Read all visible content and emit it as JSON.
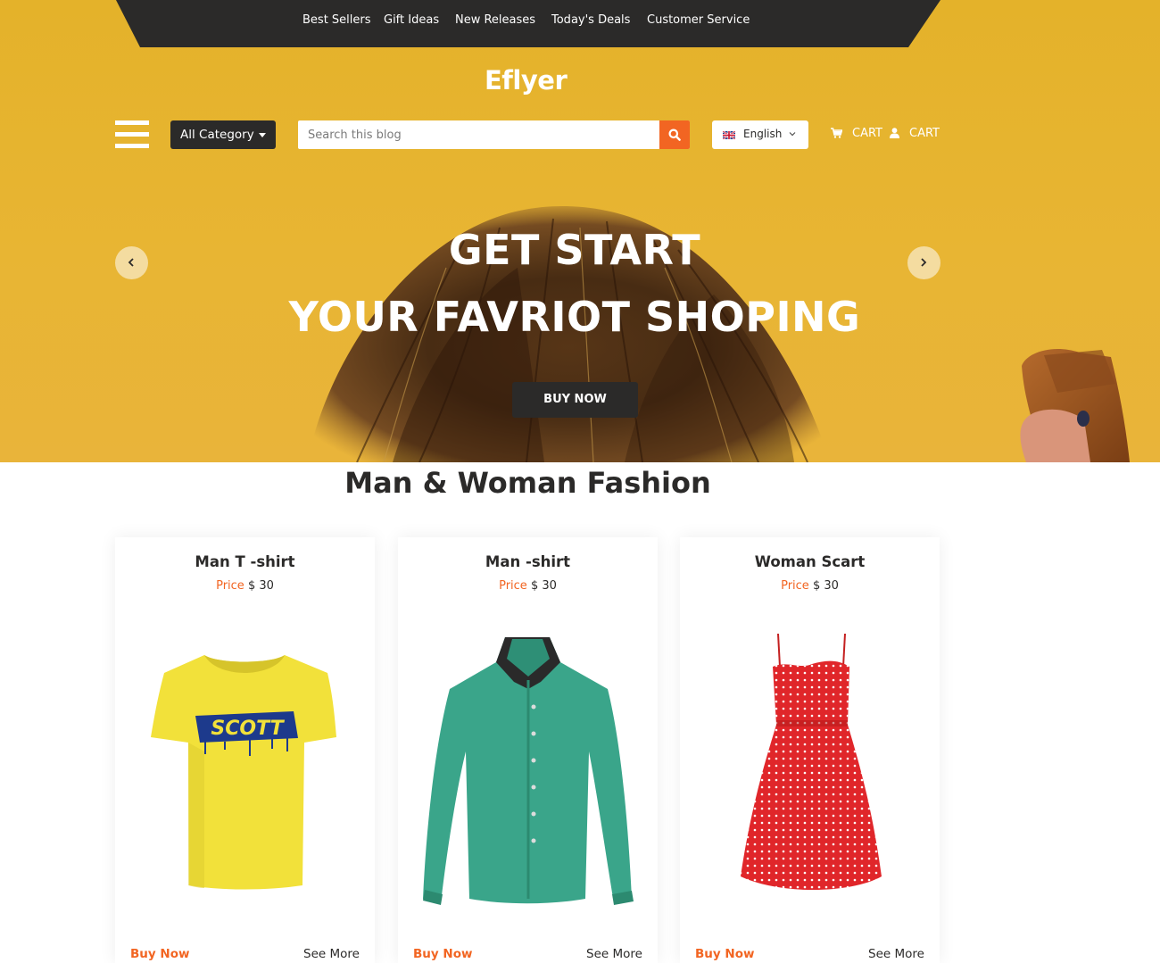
{
  "topnav": {
    "links": [
      "Best Sellers",
      "Gift Ideas",
      "New Releases",
      "Today's Deals",
      "Customer Service"
    ]
  },
  "brand": {
    "logo": "Eflyer"
  },
  "toolbar": {
    "category_label": "All Category",
    "search_placeholder": "Search this blog",
    "language_label": "English",
    "cart_label": "CART",
    "account_label": "CART"
  },
  "hero": {
    "line1": "GET START",
    "line2": "YOUR FAVRIOT SHOPING",
    "button_label": "BUY NOW"
  },
  "section": {
    "title": "Man & Woman Fashion"
  },
  "products": [
    {
      "title": "Man T -shirt",
      "price_label": "Price",
      "price_value": "$ 30",
      "buy_label": "Buy Now",
      "more_label": "See More",
      "image": "yellow-tshirt"
    },
    {
      "title": "Man -shirt",
      "price_label": "Price",
      "price_value": "$ 30",
      "buy_label": "Buy Now",
      "more_label": "See More",
      "image": "green-shirt"
    },
    {
      "title": "Woman Scart",
      "price_label": "Price",
      "price_value": "$ 30",
      "buy_label": "Buy Now",
      "more_label": "See More",
      "image": "red-polka-dress"
    }
  ],
  "icons": {
    "menu": "hamburger-icon",
    "search": "search-icon",
    "flag": "uk-flag-icon",
    "dropdown": "chevron-down-icon",
    "cart": "shopping-cart-icon",
    "account": "user-icon",
    "prev": "chevron-left-icon",
    "next": "chevron-right-icon"
  },
  "colors": {
    "hero_bg": "#e6b32e",
    "dark": "#2b2a29",
    "accent": "#f26522"
  }
}
